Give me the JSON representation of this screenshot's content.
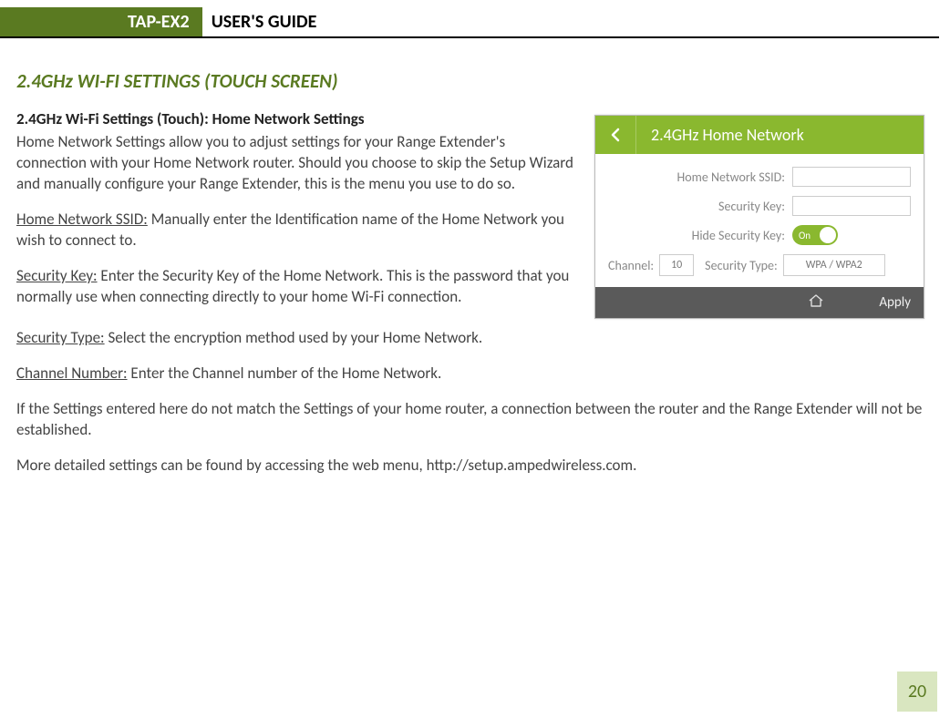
{
  "header": {
    "product": "TAP-EX2",
    "doc_title": "USER'S GUIDE"
  },
  "section_title": "2.4GHz WI-FI SETTINGS (TOUCH SCREEN)",
  "subheading": "2.4GHz Wi-Fi Settings (Touch): Home Network Settings",
  "intro": "Home Network Settings allow you to adjust settings for your Range Extender's connection with your Home Network router. Should you choose to skip the Setup Wizard and manually configure your Range Extender, this is the menu you use to do so.",
  "defs": {
    "ssid_label": "Home Network SSID:",
    "ssid_text": " Manually enter the Identification name of the Home Network you wish to connect to.",
    "seckey_label": "Security Key:",
    "seckey_text": " Enter the Security Key of the Home Network. This is the password that you normally use when connecting directly to your home Wi-Fi connection.",
    "sectype_label": "Security Type:",
    "sectype_text": " Select the encryption method used by your Home Network.",
    "chan_label": "Channel Number:",
    "chan_text": " Enter the Channel number of the Home Network."
  },
  "warning": "If the Settings entered here do not match the Settings of your home router, a connection between the router and the Range Extender will not be established.",
  "more": "More detailed settings can be found by accessing the web menu, http://setup.ampedwireless.com.",
  "figure": {
    "title": "2.4GHz Home Network",
    "ssid_label": "Home Network SSID:",
    "seckey_label": "Security Key:",
    "hide_label": "Hide Security Key:",
    "toggle_state": "On",
    "channel_label": "Channel:",
    "channel_value": "10",
    "sectype_label": "Security Type:",
    "sectype_value": "WPA / WPA2",
    "apply": "Apply"
  },
  "page_number": "20"
}
